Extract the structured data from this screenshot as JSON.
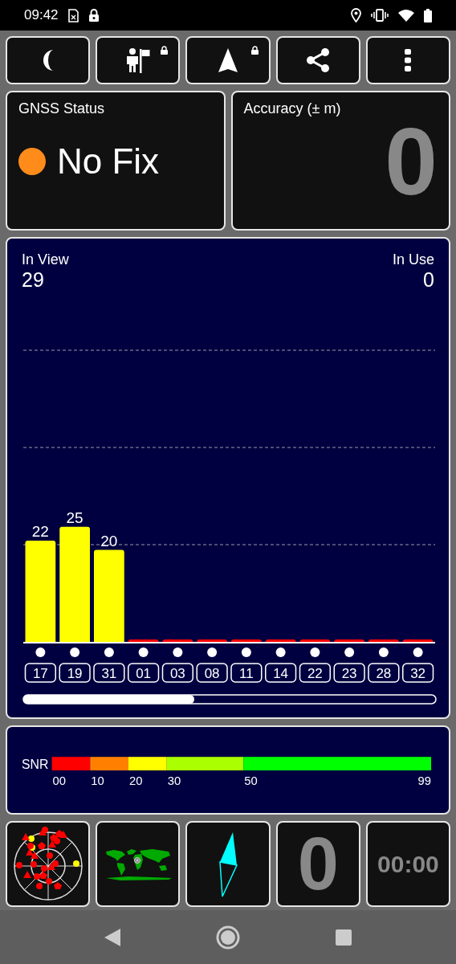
{
  "status_bar": {
    "time": "09:42"
  },
  "toolbar": [
    {
      "kind": "night",
      "locked": false
    },
    {
      "kind": "waypoint",
      "locked": true
    },
    {
      "kind": "navigate",
      "locked": true
    },
    {
      "kind": "share",
      "locked": false
    },
    {
      "kind": "menu",
      "locked": false
    }
  ],
  "gnss_status": {
    "title": "GNSS Status",
    "state": "No Fix",
    "color": "#ff8c1a"
  },
  "accuracy": {
    "title": "Accuracy (± m)",
    "value": "0"
  },
  "satellites": {
    "in_view_label": "In View",
    "in_view": "29",
    "in_use_label": "In Use",
    "in_use": "0",
    "chart_data": {
      "type": "bar",
      "categories": [
        "17",
        "19",
        "31",
        "01",
        "03",
        "08",
        "11",
        "14",
        "22",
        "23",
        "28",
        "32"
      ],
      "series": [
        {
          "values": [
            22,
            25,
            20,
            null,
            null,
            null,
            null,
            null,
            null,
            null,
            null,
            null
          ]
        }
      ],
      "data_labels": true
    }
  },
  "snr_legend": {
    "label": "SNR",
    "stops": [
      {
        "label": "00",
        "color": "#ff0000"
      },
      {
        "label": "10",
        "color": "#ff8000"
      },
      {
        "label": "20",
        "color": "#ffff00"
      },
      {
        "label": "30",
        "color": "#aaff00"
      },
      {
        "label": "50",
        "color": "#00ff00"
      },
      {
        "label": "99"
      }
    ]
  },
  "tiles": [
    {
      "kind": "skyplot"
    },
    {
      "kind": "map"
    },
    {
      "kind": "compass"
    },
    {
      "kind": "counter",
      "value": "0"
    },
    {
      "kind": "timer",
      "value": "00:00"
    }
  ]
}
